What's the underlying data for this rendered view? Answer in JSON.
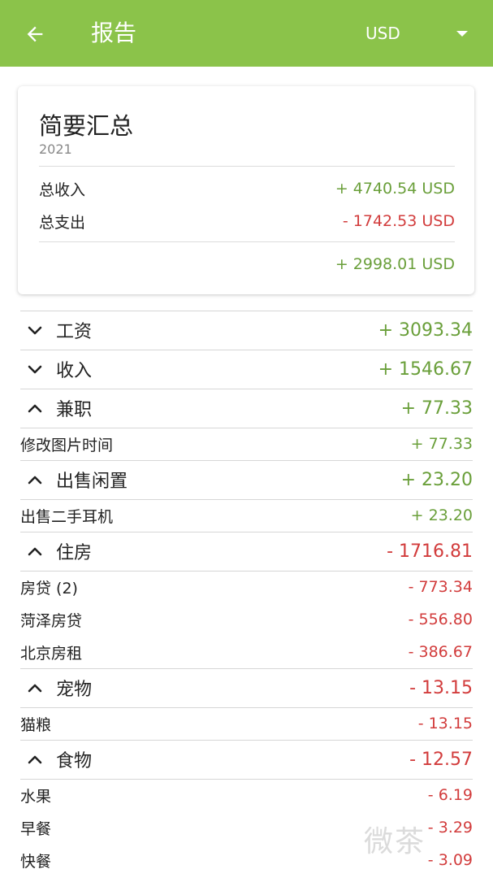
{
  "appbar": {
    "title": "报告",
    "currency": "USD",
    "accent": "#8bc34a"
  },
  "summary": {
    "title": "简要汇总",
    "year": "2021",
    "income_label": "总收入",
    "income_value": "+ 4740.54 USD",
    "expense_label": "总支出",
    "expense_value": "- 1742.53 USD",
    "net_value": "+ 2998.01 USD"
  },
  "categories": [
    {
      "name": "工资",
      "amount": "+ 3093.34",
      "expanded": false,
      "items": []
    },
    {
      "name": "收入",
      "amount": "+ 1546.67",
      "expanded": false,
      "items": []
    },
    {
      "name": "兼职",
      "amount": "+ 77.33",
      "expanded": true,
      "items": [
        {
          "name": "修改图片时间",
          "amount": "+ 77.33"
        }
      ]
    },
    {
      "name": "出售闲置",
      "amount": "+ 23.20",
      "expanded": true,
      "items": [
        {
          "name": "出售二手耳机",
          "amount": "+ 23.20"
        }
      ]
    },
    {
      "name": "住房",
      "amount": "- 1716.81",
      "expanded": true,
      "items": [
        {
          "name": "房贷 (2)",
          "amount": "- 773.34"
        },
        {
          "name": "菏泽房贷",
          "amount": "- 556.80"
        },
        {
          "name": "北京房租",
          "amount": "- 386.67"
        }
      ]
    },
    {
      "name": "宠物",
      "amount": "- 13.15",
      "expanded": true,
      "items": [
        {
          "name": "猫粮",
          "amount": "- 13.15"
        }
      ]
    },
    {
      "name": "食物",
      "amount": "- 12.57",
      "expanded": true,
      "items": [
        {
          "name": "水果",
          "amount": "- 6.19"
        },
        {
          "name": "早餐",
          "amount": "- 3.29"
        },
        {
          "name": "快餐",
          "amount": "- 3.09"
        }
      ]
    }
  ],
  "watermark": "微茶",
  "colors": {
    "positive": "#6a9f3a",
    "negative": "#d23c3c"
  }
}
